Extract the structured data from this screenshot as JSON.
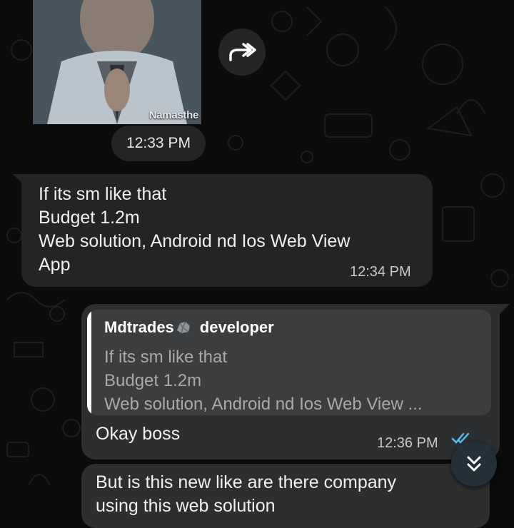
{
  "image_message": {
    "caption": "Namasthe",
    "time": "12:33 PM"
  },
  "icons": {
    "forward": "forward-icon",
    "scroll_down": "double-chevron-down-icon",
    "read_receipt": "double-check-icon"
  },
  "incoming_message": {
    "text": "If its sm like that\nBudget 1.2m\nWeb solution, Android nd Ios Web View\nApp",
    "time": "12:34 PM"
  },
  "outgoing_message": {
    "quote_author": "Mdtrades",
    "quote_author_role": "developer",
    "quote_text": "If its sm like that\nBudget 1.2m\nWeb solution, Android nd Ios Web View ...",
    "text": "Okay boss",
    "time": "12:36 PM"
  },
  "outgoing_message_2": {
    "text": "But is this new like are there company using this web solution"
  },
  "colors": {
    "background": "#0b0b0b",
    "bubble_incoming": "#222425",
    "bubble_outgoing": "#2c2e30",
    "quote_bg": "#3b3d3f",
    "tick_blue": "#53bdeb",
    "scroll_button": "#233037"
  }
}
